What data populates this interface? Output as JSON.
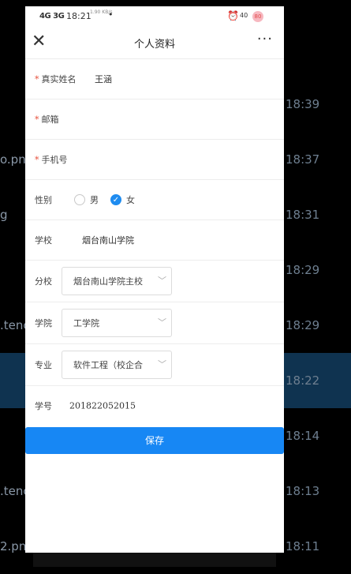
{
  "background_list": [
    {
      "left": "",
      "time": "18:39"
    },
    {
      "left": "o.png",
      "time": "18:37"
    },
    {
      "left": "g",
      "time": "18:31"
    },
    {
      "left": "",
      "time": "18:29"
    },
    {
      "left": ".tenc",
      "time": "18:29"
    },
    {
      "left": "",
      "time": "18:22"
    },
    {
      "left": "",
      "time": "18:14"
    },
    {
      "left": ".tenc",
      "time": "18:13"
    },
    {
      "left": "2.png",
      "time": "18:11"
    }
  ],
  "status_bar": {
    "signal": "4G 3G",
    "time": "18:21",
    "speed": "1.90 KB/s",
    "network": "40",
    "avatar": "80"
  },
  "nav": {
    "close_icon": "close-icon",
    "title": "个人资料",
    "more": "···"
  },
  "form": {
    "name_label": "真实姓名",
    "name_value": "王涵",
    "email_label": "邮箱",
    "email_value": "",
    "phone_label": "手机号",
    "phone_value": "",
    "gender_label": "性别",
    "gender_male": "男",
    "gender_female": "女",
    "gender_selected": "女",
    "school_label": "学校",
    "school_value": "烟台南山学院",
    "branch_label": "分校",
    "branch_value": "烟台南山学院主校",
    "college_label": "学院",
    "college_value": "工学院",
    "major_label": "专业",
    "major_value": "软件工程（校企合",
    "student_id_label": "学号",
    "student_id_value": "201822052015",
    "required_mark": "*"
  },
  "save_label": "保存",
  "colors": {
    "accent": "#1787f4",
    "required": "#e6503c"
  }
}
